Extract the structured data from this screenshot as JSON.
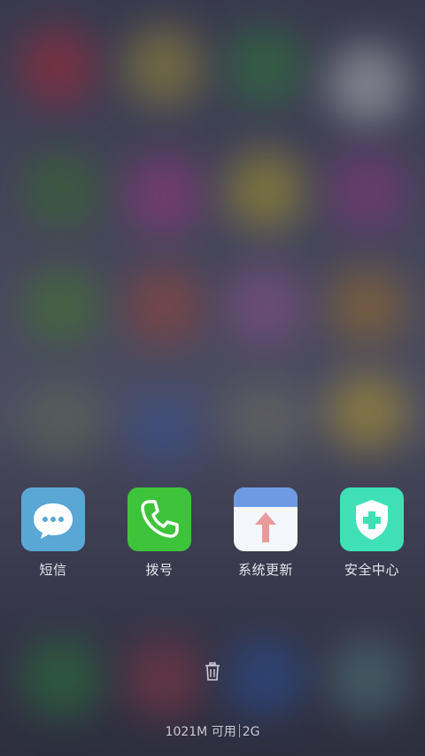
{
  "recent_apps": [
    {
      "label": "短信",
      "icon": "message-bubble-icon",
      "color": "#5aa7d6"
    },
    {
      "label": "拨号",
      "icon": "phone-icon",
      "color": "#3ec43a"
    },
    {
      "label": "系统更新",
      "icon": "system-update-icon",
      "color": "#6e9ae3"
    },
    {
      "label": "安全中心",
      "icon": "shield-plus-icon",
      "color": "#3fe0b5"
    }
  ],
  "clear_all_icon": "trash-icon",
  "memory": {
    "available": "1021M 可用",
    "network": "2G"
  }
}
